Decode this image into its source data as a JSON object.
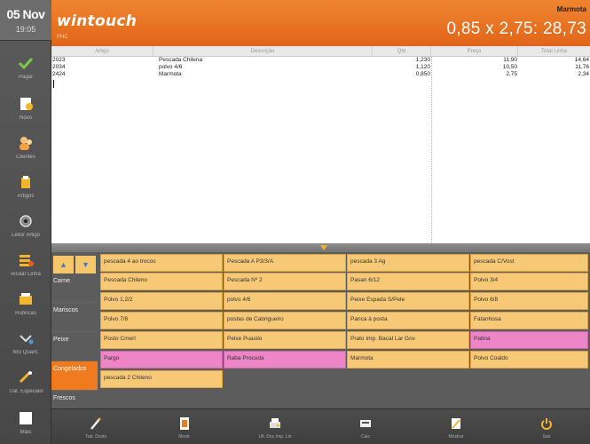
{
  "datetime": {
    "day": "05 Nov",
    "time": "19:05"
  },
  "app": {
    "logo": "wintouch",
    "logo_sub": "PHC"
  },
  "header": {
    "operator": "Marmota",
    "formula": "0,85 x 2,75: 28,73"
  },
  "sidebar": {
    "items": [
      {
        "label": "Pagar",
        "icon": "check-icon"
      },
      {
        "label": "Novo",
        "icon": "new-document-icon"
      },
      {
        "label": "Clientes",
        "icon": "clients-icon"
      },
      {
        "label": "Artigos",
        "icon": "articles-icon"
      },
      {
        "label": "Leitor Artigo",
        "icon": "barcode-reader-icon"
      },
      {
        "label": "Anular Linha",
        "icon": "cancel-line-icon"
      },
      {
        "label": "Rubricas",
        "icon": "rubricas-icon"
      },
      {
        "label": "Nro Quant.",
        "icon": "quantity-icon"
      },
      {
        "label": "Trat. Especiais",
        "icon": "special-treatment-icon"
      },
      {
        "label": "Mais",
        "icon": "more-icon"
      }
    ]
  },
  "table": {
    "columns": [
      "Artigo",
      "Descrição",
      "Qtd",
      "Preço",
      "Total Linha"
    ],
    "rows": [
      {
        "artigo": "2023",
        "descricao": "Pescada Chilena",
        "qtd": "1,230",
        "preco": "11,90",
        "total": "14,64"
      },
      {
        "artigo": "2034",
        "descricao": "polvo 4/6",
        "qtd": "1,120",
        "preco": "10,50",
        "total": "11,76"
      },
      {
        "artigo": "2424",
        "descricao": "Marmota",
        "qtd": "0,850",
        "preco": "2,75",
        "total": "2,34"
      }
    ]
  },
  "categories": [
    "Carne",
    "Mariscos",
    "Peixe",
    "Congelados",
    "Frescos"
  ],
  "active_category": "Congelados",
  "scroll_buttons": {
    "up": "▲",
    "down": "▼"
  },
  "products": [
    [
      "pescada 4 ao trocos",
      "Pescada A P3/3/A",
      "pescada 3 Ag",
      "pescada C/Vost"
    ],
    [
      "Pescada Chileno",
      "Pescada Nº 2",
      "Pasan 6/12",
      "Polvo 3/4"
    ],
    [
      "Polvo 1,2/2",
      "polvo 4/6",
      "Peixe Espada S/Pele",
      "Polvo 6/8"
    ],
    [
      "Polvo 7/8",
      "postas de Cabrigueiro",
      "Panca à posta",
      "Fatanhosa"
    ],
    [
      "Posto Cmerl",
      "Pelxe Puasilo",
      "Prato Imp. Bacal Lar Gov",
      "Patina"
    ],
    [
      "Pargo",
      "Raba Procuda",
      "Marmota",
      "Polvo Coaldo"
    ],
    [
      "pescada 2 Chileno",
      "",
      "",
      ""
    ]
  ],
  "toolbar": [
    {
      "label": "Trat. Doxto",
      "icon": "pencil-icon"
    },
    {
      "label": "Mostr.",
      "icon": "document-icon"
    },
    {
      "label": "Ult. Doc.Imp. Lln",
      "icon": "print-icon"
    },
    {
      "label": "Calc",
      "icon": "calculator-icon"
    },
    {
      "label": "Mostrar",
      "icon": "edit-icon"
    },
    {
      "label": "Sair",
      "icon": "power-icon"
    }
  ],
  "colors": {
    "accent": "#f07a1e",
    "product_tile": "#f7c977",
    "product_tile_pink": "#ee85c7",
    "scroll_arrow": "#4a78c8"
  }
}
